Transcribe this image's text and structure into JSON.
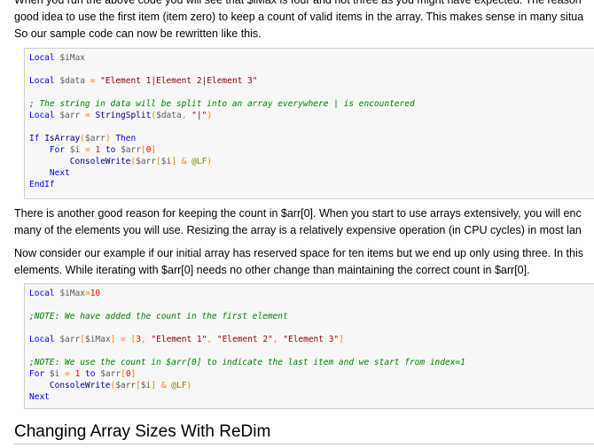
{
  "intro": {
    "line1": "When you run the above code you will see that $iMax is four and not three as you might have expected. The reason",
    "line2": "good idea to use the first item (item zero) to keep a count of valid items in the array. This makes sense in many situa",
    "line3": "So our sample code can now be rewritten like this."
  },
  "code1": {
    "l1": [
      {
        "c": "kw",
        "t": "Local"
      },
      {
        "c": "pl",
        "t": " "
      },
      {
        "c": "var",
        "t": "$iMax"
      }
    ],
    "l2": [
      {
        "c": "kw",
        "t": "Local"
      },
      {
        "c": "pl",
        "t": " "
      },
      {
        "c": "var",
        "t": "$data"
      },
      {
        "c": "pl",
        "t": " "
      },
      {
        "c": "op",
        "t": "="
      },
      {
        "c": "pl",
        "t": " "
      },
      {
        "c": "str",
        "t": "\"Element 1|Element 2|Element 3\""
      }
    ],
    "l3": [
      {
        "c": "cmt",
        "t": "; The string in data will be split into an array everywhere | is encountered"
      }
    ],
    "l4": [
      {
        "c": "kw",
        "t": "Local"
      },
      {
        "c": "pl",
        "t": " "
      },
      {
        "c": "var",
        "t": "$arr"
      },
      {
        "c": "pl",
        "t": " "
      },
      {
        "c": "op",
        "t": "="
      },
      {
        "c": "pl",
        "t": " "
      },
      {
        "c": "fn",
        "t": "StringSplit"
      },
      {
        "c": "op",
        "t": "("
      },
      {
        "c": "var",
        "t": "$data"
      },
      {
        "c": "op",
        "t": ","
      },
      {
        "c": "pl",
        "t": " "
      },
      {
        "c": "str",
        "t": "\"|\""
      },
      {
        "c": "op",
        "t": ")"
      }
    ],
    "l5": [
      {
        "c": "kw",
        "t": "If"
      },
      {
        "c": "pl",
        "t": " "
      },
      {
        "c": "fn",
        "t": "IsArray"
      },
      {
        "c": "op",
        "t": "("
      },
      {
        "c": "var",
        "t": "$arr"
      },
      {
        "c": "op",
        "t": ")"
      },
      {
        "c": "pl",
        "t": " "
      },
      {
        "c": "kw",
        "t": "Then"
      }
    ],
    "l6": [
      {
        "c": "pl",
        "t": "    "
      },
      {
        "c": "kw",
        "t": "For"
      },
      {
        "c": "pl",
        "t": " "
      },
      {
        "c": "var",
        "t": "$i"
      },
      {
        "c": "pl",
        "t": " "
      },
      {
        "c": "op",
        "t": "="
      },
      {
        "c": "pl",
        "t": " "
      },
      {
        "c": "num",
        "t": "1"
      },
      {
        "c": "pl",
        "t": " "
      },
      {
        "c": "kw",
        "t": "to"
      },
      {
        "c": "pl",
        "t": " "
      },
      {
        "c": "var",
        "t": "$arr"
      },
      {
        "c": "op",
        "t": "["
      },
      {
        "c": "num",
        "t": "0"
      },
      {
        "c": "op",
        "t": "]"
      }
    ],
    "l7": [
      {
        "c": "pl",
        "t": "        "
      },
      {
        "c": "fn",
        "t": "ConsoleWrite"
      },
      {
        "c": "op",
        "t": "("
      },
      {
        "c": "var",
        "t": "$arr"
      },
      {
        "c": "op",
        "t": "["
      },
      {
        "c": "var",
        "t": "$i"
      },
      {
        "c": "op",
        "t": "]"
      },
      {
        "c": "pl",
        "t": " "
      },
      {
        "c": "op",
        "t": "&"
      },
      {
        "c": "pl",
        "t": " "
      },
      {
        "c": "mac",
        "t": "@LF"
      },
      {
        "c": "op",
        "t": ")"
      }
    ],
    "l8": [
      {
        "c": "pl",
        "t": "    "
      },
      {
        "c": "kw",
        "t": "Next"
      }
    ],
    "l9": [
      {
        "c": "kw",
        "t": "EndIf"
      }
    ]
  },
  "middle": {
    "line1": "There is another good reason for keeping the count in $arr[0]. When you start to use arrays extensively, you will enc",
    "line2": "many of the elements you will use. Resizing the array is a relatively expensive operation (in CPU cycles) in most lan",
    "line3": "Now consider our example if our initial array has reserved space for ten items but we end up only using three. In this",
    "line4": "elements. While iterating with $arr[0] needs no other change than maintaining the correct count in $arr[0]."
  },
  "code2": {
    "l1": [
      {
        "c": "kw",
        "t": "Local"
      },
      {
        "c": "pl",
        "t": " "
      },
      {
        "c": "var",
        "t": "$iMax"
      },
      {
        "c": "op",
        "t": "="
      },
      {
        "c": "num",
        "t": "10"
      }
    ],
    "l2": [
      {
        "c": "cmt",
        "t": ";NOTE: We have added the count in the first element"
      }
    ],
    "l3": [
      {
        "c": "kw",
        "t": "Local"
      },
      {
        "c": "pl",
        "t": " "
      },
      {
        "c": "var",
        "t": "$arr"
      },
      {
        "c": "op",
        "t": "["
      },
      {
        "c": "var",
        "t": "$iMax"
      },
      {
        "c": "op",
        "t": "]"
      },
      {
        "c": "pl",
        "t": " "
      },
      {
        "c": "op",
        "t": "="
      },
      {
        "c": "pl",
        "t": " "
      },
      {
        "c": "op",
        "t": "["
      },
      {
        "c": "num",
        "t": "3"
      },
      {
        "c": "op",
        "t": ","
      },
      {
        "c": "pl",
        "t": " "
      },
      {
        "c": "str",
        "t": "\"Element 1\""
      },
      {
        "c": "op",
        "t": ","
      },
      {
        "c": "pl",
        "t": " "
      },
      {
        "c": "str",
        "t": "\"Element 2\""
      },
      {
        "c": "op",
        "t": ","
      },
      {
        "c": "pl",
        "t": " "
      },
      {
        "c": "str",
        "t": "\"Element 3\""
      },
      {
        "c": "op",
        "t": "]"
      }
    ],
    "l4": [
      {
        "c": "cmt",
        "t": ";NOTE: We use the count in $arr[0] to indicate the last item and we start from index=1"
      }
    ],
    "l5": [
      {
        "c": "kw",
        "t": "For"
      },
      {
        "c": "pl",
        "t": " "
      },
      {
        "c": "var",
        "t": "$i"
      },
      {
        "c": "pl",
        "t": " "
      },
      {
        "c": "op",
        "t": "="
      },
      {
        "c": "pl",
        "t": " "
      },
      {
        "c": "num",
        "t": "1"
      },
      {
        "c": "pl",
        "t": " "
      },
      {
        "c": "kw",
        "t": "to"
      },
      {
        "c": "pl",
        "t": " "
      },
      {
        "c": "var",
        "t": "$arr"
      },
      {
        "c": "op",
        "t": "["
      },
      {
        "c": "num",
        "t": "0"
      },
      {
        "c": "op",
        "t": "]"
      }
    ],
    "l6": [
      {
        "c": "pl",
        "t": "    "
      },
      {
        "c": "fn",
        "t": "ConsoleWrite"
      },
      {
        "c": "op",
        "t": "("
      },
      {
        "c": "var",
        "t": "$arr"
      },
      {
        "c": "op",
        "t": "["
      },
      {
        "c": "var",
        "t": "$i"
      },
      {
        "c": "op",
        "t": "]"
      },
      {
        "c": "pl",
        "t": " "
      },
      {
        "c": "op",
        "t": "&"
      },
      {
        "c": "pl",
        "t": " "
      },
      {
        "c": "mac",
        "t": "@LF"
      },
      {
        "c": "op",
        "t": ")"
      }
    ],
    "l7": [
      {
        "c": "kw",
        "t": "Next"
      }
    ]
  },
  "heading": "Changing Array Sizes With ReDim",
  "colors": {
    "keyword": "#0000ff",
    "variable": "#5a5a5a",
    "string": "#8b0000",
    "comment": "#008000",
    "function": "#000090",
    "operator": "#ff8000",
    "number": "#ff0000",
    "macro": "#808000",
    "code_bg": "#f7f7f7"
  }
}
